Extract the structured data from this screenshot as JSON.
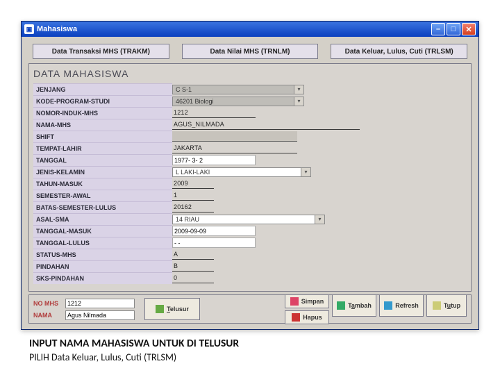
{
  "window": {
    "title": "Mahasiswa"
  },
  "tabs": {
    "trakm": "Data Transaksi MHS (TRAKM)",
    "trnlm": "Data Nilai MHS (TRNLM)",
    "trlsm": "Data Keluar, Lulus, Cuti (TRLSM)"
  },
  "section_title": "DATA MAHASISWA",
  "fields": {
    "jenjang": {
      "label": "JENJANG",
      "value": "C S-1"
    },
    "kode_program_studi": {
      "label": "KODE-PROGRAM-STUDI",
      "value": "46201 Biologi"
    },
    "nomor_induk": {
      "label": "NOMOR-INDUK-MHS",
      "value": "1212"
    },
    "nama_mhs": {
      "label": "NAMA-MHS",
      "value": "AGUS_NILMADA"
    },
    "shift": {
      "label": "SHIFT",
      "value": ""
    },
    "tempat_lahir": {
      "label": "TEMPAT-LAHIR",
      "value": "JAKARTA"
    },
    "tanggal": {
      "label": "TANGGAL",
      "value": "1977- 3- 2"
    },
    "jenis_kelamin": {
      "label": "JENIS-KELAMIN",
      "value": "L LAKI-LAKI"
    },
    "tahun_masuk": {
      "label": "TAHUN-MASUK",
      "value": "2009"
    },
    "semester_awal": {
      "label": "SEMESTER-AWAL",
      "value": "1"
    },
    "batas_semester": {
      "label": "BATAS-SEMESTER-LULUS",
      "value": "20162"
    },
    "asal_sma": {
      "label": "ASAL-SMA",
      "value": "14 RIAU"
    },
    "tanggal_masuk": {
      "label": "TANGGAL-MASUK",
      "value": "2009-09-09"
    },
    "tanggal_lulus": {
      "label": "TANGGAL-LULUS",
      "value": "-  -"
    },
    "status_mhs": {
      "label": "STATUS-MHS",
      "value": "A"
    },
    "pindahan": {
      "label": "PINDAHAN",
      "value": "B"
    },
    "sks_pindahan": {
      "label": "SKS-PINDAHAN",
      "value": "0"
    }
  },
  "search": {
    "no_mhs_label": "NO MHS",
    "no_mhs_value": "1212",
    "nama_label": "NAMA",
    "nama_value": "Agus Nilmada"
  },
  "buttons": {
    "telusur": "Telusur",
    "simpan": "Simpan",
    "hapus": "Hapus",
    "tambah": "Tambah",
    "refresh": "Refresh",
    "tutup": "Tutup"
  },
  "instructions": {
    "line1": "INPUT NAMA MAHASISWA UNTUK DI TELUSUR",
    "line2": "PILIH Data Keluar, Lulus, Cuti (TRLSM)"
  }
}
